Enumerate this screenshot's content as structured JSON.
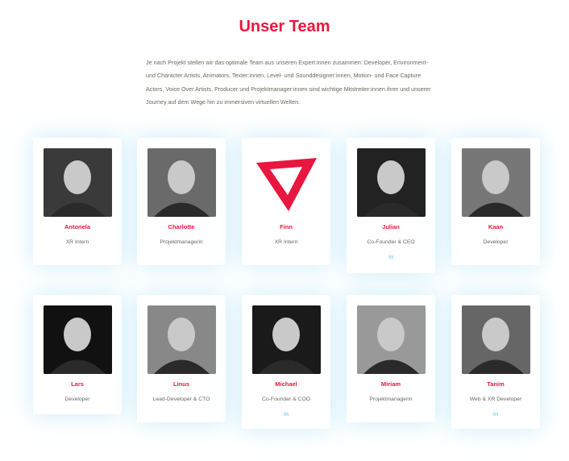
{
  "title": "Unser Team",
  "intro": "Je nach Projekt stellen wir das optimale Team aus unseren Expert:innen zusammen: Developer, Environment- und Character Artists, Animators, Texter:innen, Level- und Sounddesigner:innen, Motion- und Face Capture Actors, Voice Over Artists, Producer und Projektmanager:innen sind wichtige Mitstreiter:innen ihrer und unserer Journey auf dem Wege hin zu immersiven virtuellen Welten.",
  "members": [
    {
      "name": "Antonela",
      "role": "XR Intern"
    },
    {
      "name": "Charlotte",
      "role": "Projektmanagerin"
    },
    {
      "name": "Finn",
      "role": "XR Intern",
      "logo": true
    },
    {
      "name": "Julian",
      "role": "Co-Founder & CEO",
      "linkedin": "in"
    },
    {
      "name": "Kaan",
      "role": "Developer"
    },
    {
      "name": "Lars",
      "role": "Developer"
    },
    {
      "name": "Linus",
      "role": "Lead-Developer & CTO"
    },
    {
      "name": "Michael",
      "role": "Co-Founder & COO",
      "linkedin": "in"
    },
    {
      "name": "Miriam",
      "role": "Projektmanagerin"
    },
    {
      "name": "Tanim",
      "role": "Web & XR Developer",
      "linkedin": "in"
    }
  ],
  "colors": {
    "accent": "#e8173f",
    "linkedin": "#8ed3ef"
  }
}
